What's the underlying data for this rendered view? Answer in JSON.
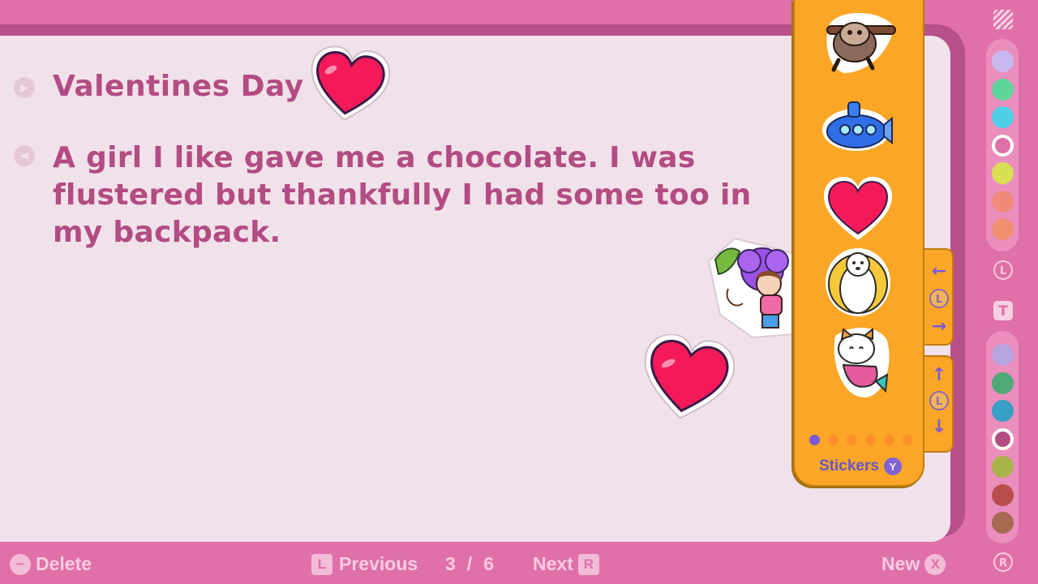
{
  "entry": {
    "title": "Valentines Day",
    "text": "A girl I like gave me a chocolate. I was flustered but thankfully I had some too in my backpack."
  },
  "sticker_panel": {
    "label": "Stickers",
    "badge": "Y",
    "items": [
      "sloth-sticker",
      "submarine-sticker",
      "heart-sticker",
      "polar-bear-sticker",
      "mermaid-cat-sticker"
    ],
    "page_count": 6,
    "active_page": 1
  },
  "page_stickers": [
    "heart-sticker",
    "girl-flower-sticker",
    "heart-sticker"
  ],
  "tabs": {
    "horizontal": {
      "left": "←",
      "badge": "L",
      "right": "→"
    },
    "vertical": {
      "up": "↑",
      "badge": "L",
      "down": "↓"
    }
  },
  "palette_top": [
    {
      "color": "#c9b8f0",
      "selected": false
    },
    {
      "color": "#5fd49a",
      "selected": false
    },
    {
      "color": "#4dcfe8",
      "selected": false
    },
    {
      "color": "#e070a8",
      "selected": true
    },
    {
      "color": "#d8df55",
      "selected": false
    },
    {
      "color": "#f08a7a",
      "selected": false
    },
    {
      "color": "#f09070",
      "selected": false
    }
  ],
  "palette_bottom": [
    {
      "color": "#b8a4e0",
      "selected": false
    },
    {
      "color": "#4fa878",
      "selected": false
    },
    {
      "color": "#3a9fc4",
      "selected": false
    },
    {
      "color": "#b24c82",
      "selected": true
    },
    {
      "color": "#a8b44a",
      "selected": false
    },
    {
      "color": "#b84e4c",
      "selected": false
    },
    {
      "color": "#a86a50",
      "selected": false
    }
  ],
  "rail": {
    "top_badge": "L",
    "text_tool": "T",
    "bottom_badge": "R"
  },
  "bottom_bar": {
    "delete_label": "Delete",
    "delete_key": "−",
    "previous_key": "L",
    "previous_label": "Previous",
    "current_page": "3",
    "separator": "/",
    "total_pages": "6",
    "next_label": "Next",
    "next_key": "R",
    "new_label": "New",
    "new_key": "X"
  }
}
